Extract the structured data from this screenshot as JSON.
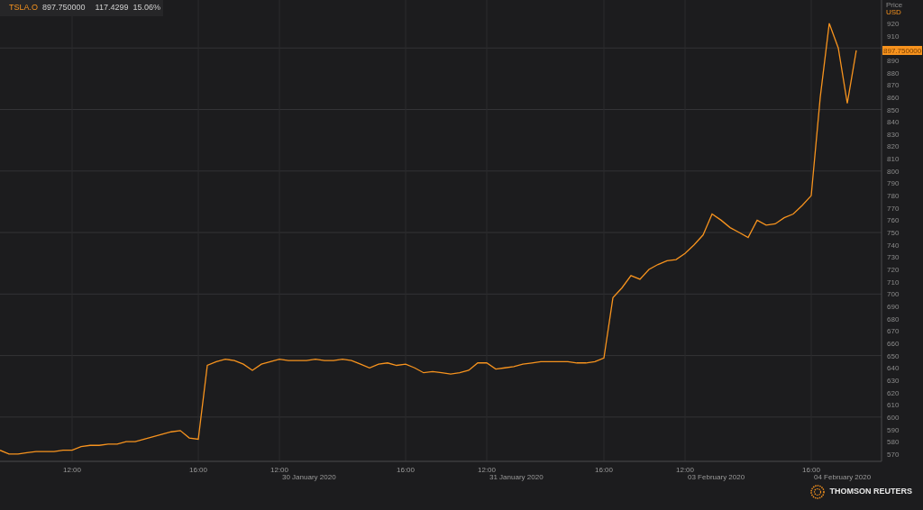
{
  "header": {
    "price": "897.750000",
    "change": "117.4299",
    "change_pct": "15.06%"
  },
  "axis_unit": "USD",
  "price_tag": {
    "text": "897.750000"
  },
  "chart_data": {
    "type": "line",
    "ylabel": "Price",
    "ylim": [
      564,
      939
    ],
    "grid": true,
    "categories": [
      null,
      null,
      null,
      null,
      null,
      null,
      null,
      null,
      "12:00",
      null,
      null,
      null,
      null,
      null,
      null,
      null,
      null,
      null,
      null,
      null,
      null,
      null,
      "16:00",
      null,
      null,
      null,
      null,
      null,
      null,
      null,
      null,
      "12:00",
      null,
      null,
      null,
      null,
      null,
      null,
      null,
      null,
      null,
      null,
      null,
      null,
      null,
      "16:00",
      null,
      null,
      null,
      null,
      null,
      null,
      null,
      null,
      "12:00",
      null,
      null,
      null,
      null,
      null,
      null,
      null,
      null,
      null,
      null,
      null,
      null,
      "16:00",
      null,
      null,
      null,
      null,
      null,
      null,
      null,
      null,
      "12:00",
      null,
      null,
      null,
      null,
      null,
      null,
      null,
      null,
      null,
      null,
      null,
      null,
      null,
      "16:00",
      null,
      null,
      null,
      null,
      null
    ],
    "series": [
      {
        "name": "TSLA.O",
        "color": "#f7931e",
        "values": [
          573,
          570,
          570,
          571,
          572,
          572,
          572,
          573,
          573,
          576,
          577,
          577,
          578,
          578,
          580,
          580,
          582,
          584,
          586,
          588,
          589,
          583,
          582,
          642,
          645,
          647,
          646,
          643,
          638,
          643,
          645,
          647,
          646,
          646,
          646,
          647,
          646,
          646,
          647,
          646,
          643,
          640,
          643,
          644,
          642,
          643,
          640,
          636,
          637,
          636,
          635,
          636,
          638,
          644,
          644,
          639,
          640,
          641,
          643,
          644,
          645,
          645,
          645,
          645,
          644,
          644,
          645,
          648,
          697,
          705,
          715,
          712,
          720,
          724,
          727,
          728,
          733,
          740,
          748,
          765,
          760,
          754,
          750,
          746,
          760,
          756,
          757,
          762,
          765,
          772,
          780,
          860,
          920,
          900,
          855,
          898
        ]
      }
    ],
    "yticks": [
      570,
      580,
      590,
      600,
      610,
      620,
      630,
      640,
      650,
      660,
      670,
      680,
      690,
      700,
      710,
      720,
      730,
      740,
      750,
      760,
      770,
      780,
      790,
      800,
      810,
      820,
      830,
      840,
      850,
      860,
      870,
      880,
      890,
      910,
      920
    ],
    "annotations": [
      "30 January 2020",
      "31 January 2020",
      "03 February 2020",
      "04 February 2020"
    ]
  },
  "logo": {
    "text": "THOMSON REUTERS"
  }
}
